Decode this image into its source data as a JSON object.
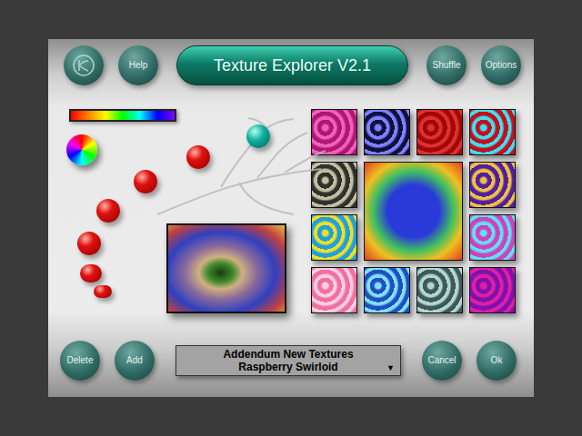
{
  "title": "Texture Explorer V2.1",
  "top_left_buttons": [
    {
      "label": "Help"
    }
  ],
  "top_right_buttons": [
    {
      "label": "Shuffle"
    },
    {
      "label": "Options"
    }
  ],
  "bottom_left_buttons": [
    {
      "label": "Delete"
    },
    {
      "label": "Add"
    }
  ],
  "bottom_right_buttons": [
    {
      "label": "Cancel"
    },
    {
      "label": "Ok"
    }
  ],
  "texture_menu": {
    "category": "Addendum New Textures",
    "selection": "Raspberry Swirloid",
    "arrow": "▼"
  },
  "preview": {
    "color": "#2a3ad8",
    "accent": "#f0c020"
  },
  "textures": [
    {
      "color": "#b01870",
      "accent": "#f060c0"
    },
    {
      "color": "#101040",
      "accent": "#8080ff"
    },
    {
      "color": "#a00808",
      "accent": "#e03030"
    },
    {
      "color": "#c01020",
      "accent": "#40e0f0"
    },
    {
      "color": "#303030",
      "accent": "#c0c0a0"
    },
    {
      "color": "#5020a0",
      "accent": "#f0c040"
    },
    {
      "color": "#20a0e0",
      "accent": "#f0e020"
    },
    {
      "color": "#d040c0",
      "accent": "#60e0f0"
    },
    {
      "color": "#f070a0",
      "accent": "#ffd0e0"
    },
    {
      "color": "#2050c0",
      "accent": "#80e0ff"
    },
    {
      "color": "#405858",
      "accent": "#b0d8d0"
    },
    {
      "color": "#8010b0",
      "accent": "#e020a0"
    }
  ]
}
